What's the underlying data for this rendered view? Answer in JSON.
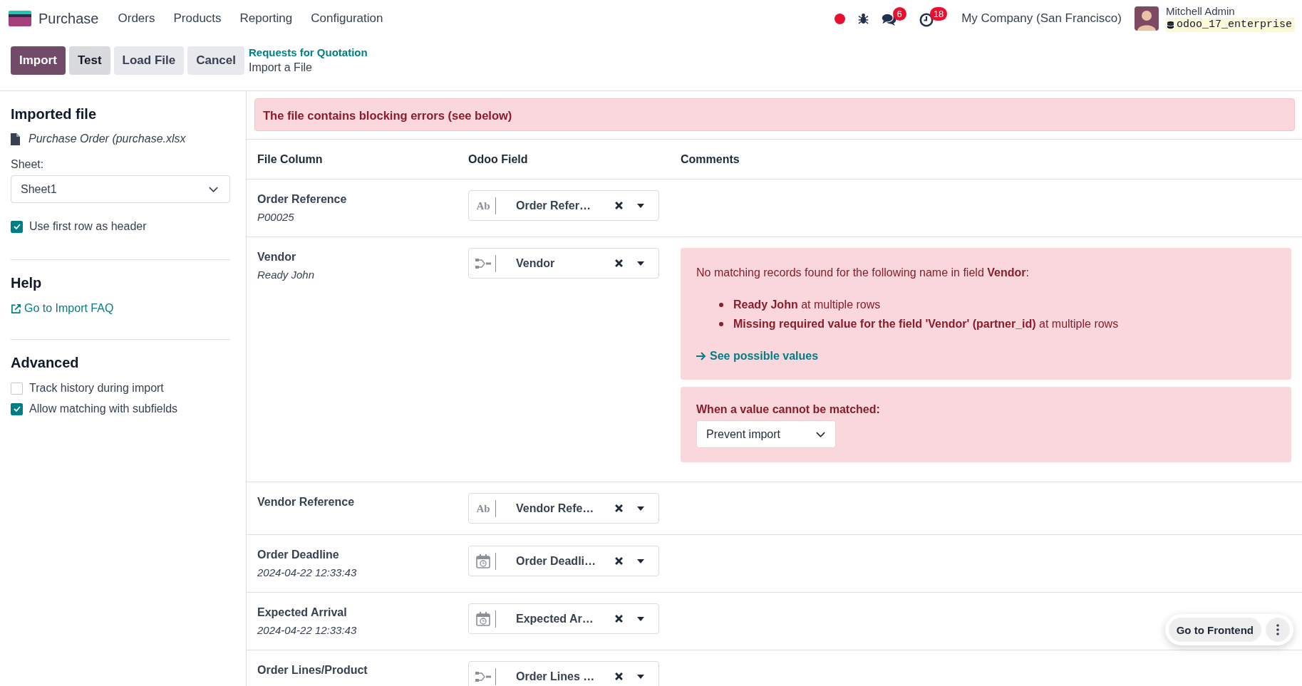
{
  "navbar": {
    "app_name": "Purchase",
    "menu": [
      "Orders",
      "Products",
      "Reporting",
      "Configuration"
    ],
    "systray": [
      {
        "kind": "dot"
      },
      {
        "kind": "bug"
      },
      {
        "kind": "chat",
        "badge": "6"
      },
      {
        "kind": "clock",
        "badge": "18"
      }
    ],
    "company": "My Company (San Francisco)",
    "user": {
      "name": "Mitchell Admin",
      "database": "odoo_17_enterprise"
    }
  },
  "control_panel": {
    "buttons": [
      {
        "label": "Import",
        "kind": "primary",
        "highlighted": false
      },
      {
        "label": "Test",
        "kind": "secondary",
        "highlighted": true
      },
      {
        "label": "Load File",
        "kind": "secondary",
        "highlighted": false
      },
      {
        "label": "Cancel",
        "kind": "secondary",
        "highlighted": false
      }
    ],
    "breadcrumb": {
      "parent": "Requests for Quotation",
      "current": "Import a File"
    }
  },
  "sidebar": {
    "imported_file": {
      "title": "Imported file",
      "file_name": "Purchase Order (purchase.xlsx",
      "sheet_label": "Sheet:",
      "sheet": "Sheet1",
      "options": [
        {
          "label": "Use first row as header",
          "checked": true
        }
      ]
    },
    "help": {
      "title": "Help",
      "link": "Go to Import FAQ"
    },
    "advanced": {
      "title": "Advanced",
      "options": [
        {
          "label": "Track history during import",
          "checked": false
        },
        {
          "label": "Allow matching with subfields",
          "checked": true
        }
      ]
    }
  },
  "alert": "The file contains blocking errors (see below)",
  "table": {
    "columns": [
      "File Column",
      "Odoo Field",
      "Comments"
    ],
    "rows": [
      {
        "name": "Order Reference",
        "sample": "P00025",
        "field": {
          "kind": "text",
          "icon_text": "Ab",
          "label": "Order Refer…"
        }
      },
      {
        "name": "Vendor",
        "sample": "Ready John",
        "field": {
          "kind": "relation",
          "label": "Vendor"
        },
        "comments": {
          "message": "No matching records found for the following name in field **Vendor**:",
          "items": [
            "**Ready John** at multiple rows",
            "**Missing required value for the field 'Vendor' (partner_id)** at multiple rows"
          ],
          "link": "See possible values",
          "fallback_label": "When a value cannot be matched:",
          "fallback_value": "Prevent import"
        }
      },
      {
        "name": "Vendor Reference",
        "field": {
          "kind": "text",
          "icon_text": "Ab",
          "label": "Vendor Refe…"
        }
      },
      {
        "name": "Order Deadline",
        "sample": "2024-04-22 12:33:43",
        "field": {
          "kind": "datetime",
          "label": "Order Deadli…"
        }
      },
      {
        "name": "Expected Arrival",
        "sample": "2024-04-22 12:33:43",
        "field": {
          "kind": "datetime",
          "label": "Expected Ar…"
        }
      },
      {
        "name": "Order Lines/Product",
        "field": {
          "kind": "relation",
          "label": "Order Lines …"
        }
      }
    ]
  },
  "frontend_bar": {
    "button": "Go to Frontend"
  }
}
